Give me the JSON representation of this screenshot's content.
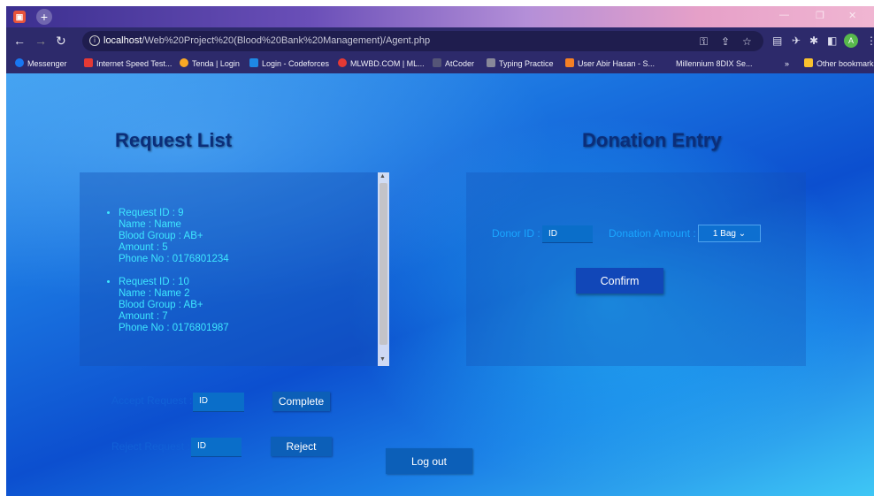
{
  "browser": {
    "new_tab": "+",
    "window_controls": {
      "minimize": "—",
      "maximize": "❐",
      "close": "✕"
    },
    "url_host": "localhost",
    "url_path": "/Web%20Project%20(Blood%20Bank%20Management)/Agent.php",
    "bookmarks": [
      {
        "label": "Messenger",
        "color": "#1877f2"
      },
      {
        "label": "Internet Speed Test...",
        "color": "#e53935"
      },
      {
        "label": "Tenda | Login",
        "color": "#f9a825"
      },
      {
        "label": "Login - Codeforces",
        "color": "#1e88e5"
      },
      {
        "label": "MLWBD.COM | ML...",
        "color": "#e53935"
      },
      {
        "label": "AtCoder",
        "color": "#555577"
      },
      {
        "label": "Typing Practice",
        "color": "#888899"
      },
      {
        "label": "User Abir Hasan - S...",
        "color": "#f48024"
      },
      {
        "label": "Millennium 8DIX Se...",
        "color": "#2d2a6b"
      }
    ],
    "more_bookmarks": "»",
    "other_bookmarks": "Other bookmarks",
    "avatar_letter": "A"
  },
  "request_list": {
    "title": "Request List",
    "items": [
      {
        "id": "Request ID : 9",
        "name": "Name : Name",
        "group": "Blood Group : AB+",
        "amount": "Amount : 5",
        "phone": "Phone No : 0176801234"
      },
      {
        "id": "Request ID : 10",
        "name": "Name : Name 2",
        "group": "Blood Group : AB+",
        "amount": "Amount : 7",
        "phone": "Phone No : 0176801987"
      }
    ]
  },
  "donation": {
    "title": "Donation Entry",
    "donor_label": "Donor ID :",
    "donor_value": "ID",
    "amount_label": "Donation Amount :",
    "amount_value": "1 Bag",
    "confirm": "Confirm"
  },
  "actions": {
    "accept_label": "Accept Request :",
    "accept_value": "ID",
    "complete": "Complete",
    "reject_label": "Reject Request :",
    "reject_value": "ID",
    "reject": "Reject",
    "logout": "Log out"
  }
}
